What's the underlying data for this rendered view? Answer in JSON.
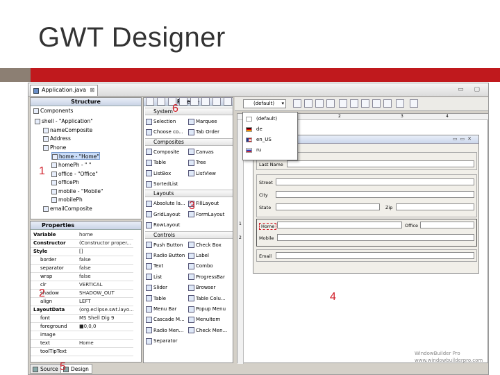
{
  "slide": {
    "title": "GWT Designer"
  },
  "editor": {
    "tab_label": "Application.java",
    "tab_close": "⊠",
    "window_controls": "▭ ▢"
  },
  "structure": {
    "header": "Structure",
    "components_label": "Components",
    "tree": [
      {
        "label": "shell - \"Application\"",
        "indent": 0
      },
      {
        "label": "nameComposite",
        "indent": 1
      },
      {
        "label": "Address",
        "indent": 1
      },
      {
        "label": "Phone",
        "indent": 1
      },
      {
        "label": "home - \"Home\"",
        "indent": 2,
        "selected": true
      },
      {
        "label": "homePh - \" \"",
        "indent": 2
      },
      {
        "label": "office - \"Office\"",
        "indent": 2
      },
      {
        "label": "officePh",
        "indent": 2
      },
      {
        "label": "mobile - \"Mobile\"",
        "indent": 2
      },
      {
        "label": "mobilePh",
        "indent": 2
      },
      {
        "label": "emailComposite",
        "indent": 1
      }
    ]
  },
  "properties": {
    "header": "Properties",
    "rows": [
      {
        "name": "Variable",
        "value": "home",
        "bold": true
      },
      {
        "name": "Constructor",
        "value": "(Constructor proper...",
        "bold": true
      },
      {
        "name": "Style",
        "value": "[]",
        "bold": true
      },
      {
        "name": "border",
        "value": "false"
      },
      {
        "name": "separator",
        "value": "false"
      },
      {
        "name": "wrap",
        "value": "false"
      },
      {
        "name": "clr",
        "value": "VERTICAL"
      },
      {
        "name": "shadow",
        "value": "SHADOW_OUT"
      },
      {
        "name": "align",
        "value": "LEFT"
      },
      {
        "name": "LayoutData",
        "value": "(org.eclipse.swt.layo...",
        "bold": true
      },
      {
        "name": "font",
        "value": "MS Shell Dlg 9"
      },
      {
        "name": "foreground",
        "value": "■0,0,0"
      },
      {
        "name": "image",
        "value": ""
      },
      {
        "name": "text",
        "value": "Home"
      },
      {
        "name": "toolTipText",
        "value": ""
      }
    ]
  },
  "palette": {
    "header": "Palette",
    "sections": [
      {
        "title": "System",
        "items": [
          [
            "Selection",
            "Marquee"
          ],
          [
            "Choose co...",
            "Tab Order"
          ]
        ]
      },
      {
        "title": "Composites",
        "items": [
          [
            "Composite",
            "Canvas"
          ],
          [
            "Table",
            "Tree"
          ],
          [
            "ListBox",
            "ListView"
          ],
          [
            "SortedList",
            ""
          ]
        ]
      },
      {
        "title": "Layouts",
        "items": [
          [
            "Absolute la...",
            "FillLayout"
          ],
          [
            "GridLayout",
            "FormLayout"
          ],
          [
            "RowLayout",
            ""
          ]
        ]
      },
      {
        "title": "Controls",
        "items": [
          [
            "Push Button",
            "Check Box"
          ],
          [
            "Radio Button",
            "Label"
          ],
          [
            "Text",
            "Combo"
          ],
          [
            "List",
            "ProgressBar"
          ],
          [
            "Slider",
            "Browser"
          ],
          [
            "Table",
            "Table Colu..."
          ],
          [
            "Menu Bar",
            "Popup Menu"
          ],
          [
            "Cascade M...",
            "MenuItem"
          ],
          [
            "Radio Men...",
            "Check Men..."
          ],
          [
            "Separator",
            ""
          ]
        ]
      }
    ]
  },
  "toolbar": {
    "locale_value": "(default)"
  },
  "locale_menu": {
    "items": [
      "(default)",
      "de",
      "en_US",
      "ru"
    ]
  },
  "ruler": {
    "h": [
      "2",
      "3",
      "4"
    ],
    "v": [
      "1",
      "2"
    ]
  },
  "form": {
    "labels": {
      "last_name": "Last Name",
      "street": "Street",
      "city": "City",
      "state": "State",
      "zip": "Zip",
      "home": "Home",
      "office": "Office",
      "mobile": "Mobile",
      "email": "Email"
    }
  },
  "bottom_tabs": {
    "source": "Source",
    "design": "Design"
  },
  "callouts": {
    "n1": "1",
    "n2": "2",
    "n3": "3",
    "n4": "4",
    "n5": "5",
    "n6": "6"
  },
  "watermark": {
    "line1": "WindowBuilder Pro",
    "line2": "www.windowbuilderpro.com"
  },
  "colors": {
    "accent_red": "#c0191d",
    "accent_gray": "#8c7f73",
    "callout": "#d1202a"
  }
}
